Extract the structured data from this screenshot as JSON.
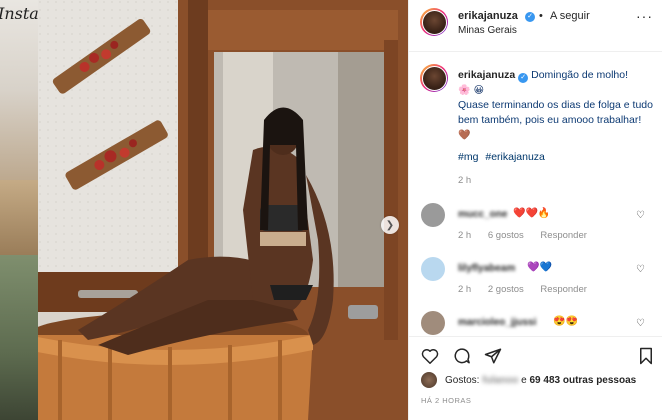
{
  "backdrop": {
    "logo_fragment": "Insta"
  },
  "header": {
    "username": "erikajanuza",
    "verified_icon": "verified-badge-icon",
    "follow_label": "A seguir",
    "location": "Minas Gerais",
    "more_icon": "more-options-icon"
  },
  "caption": {
    "username": "erikajanuza",
    "line1": "Domingão de molho!",
    "emoji1": "🌸 😀",
    "body": "Quase terminando os dias de folga e tudo bem também, pois eu amooo trabalhar!",
    "emoji2": "🤎",
    "hashtags": [
      "#mg",
      "#erikajanuza"
    ],
    "time": "2 h"
  },
  "comments": [
    {
      "user": "mucc_one",
      "text": "❤️❤️🔥",
      "time": "2 h",
      "likes": "6 gostos",
      "reply": "Responder",
      "avatar_color": "#9a9a9a"
    },
    {
      "user": "lilyflyabeam",
      "text": "💜💙",
      "time": "2 h",
      "likes": "2 gostos",
      "reply": "Responder",
      "avatar_color": "#b9d8ef"
    },
    {
      "user": "marcioleo_jjussi",
      "text": "😍😍",
      "time": "",
      "likes": "",
      "reply": "",
      "avatar_color": "#a08c7c"
    }
  ],
  "actions": {
    "like_icon": "heart-icon",
    "comment_icon": "comment-icon",
    "share_icon": "share-icon",
    "save_icon": "bookmark-icon"
  },
  "likes": {
    "prefix": "Gostos:",
    "blurred_name": "fulanoo",
    "connector": "e",
    "count": "69 483 outras pessoas"
  },
  "posted_ago": "HÁ 2 HORAS",
  "colors": {
    "verified": "#3897f0",
    "hashtag": "#00376b",
    "meta": "#8e8e8e",
    "border": "#efefef"
  }
}
